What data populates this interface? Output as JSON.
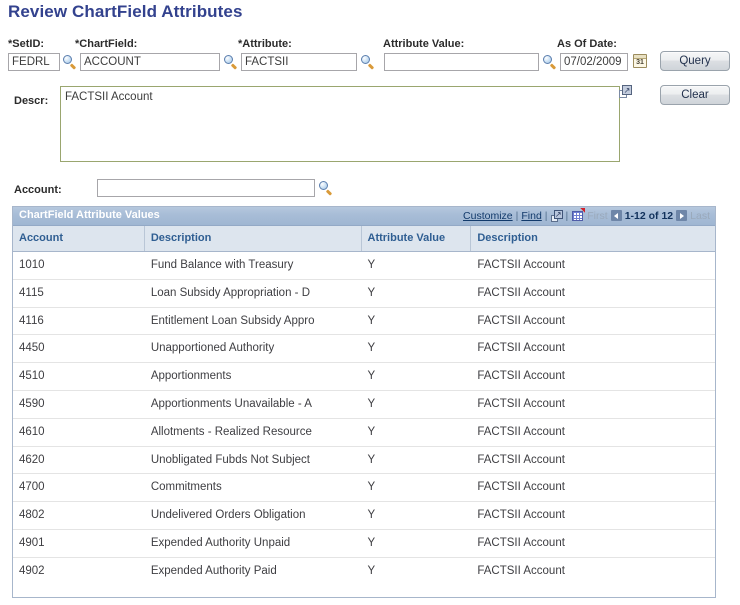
{
  "page": {
    "title": "Review ChartField Attributes"
  },
  "criteria": {
    "setid": {
      "label": "*SetID:",
      "value": "FEDRL",
      "placeholder": "",
      "lookup_icon": "magnifier-icon"
    },
    "chartfield": {
      "label": "*ChartField:",
      "value": "ACCOUNT",
      "placeholder": "",
      "lookup_icon": "magnifier-icon"
    },
    "attribute": {
      "label": "*Attribute:",
      "value": "FACTSII",
      "placeholder": "",
      "lookup_icon": "magnifier-icon"
    },
    "attribute_value": {
      "label": "Attribute Value:",
      "value": "",
      "placeholder": "",
      "lookup_icon": "magnifier-icon"
    },
    "as_of_date": {
      "label": "As Of Date:",
      "value": "07/02/2009",
      "placeholder": "",
      "calendar_icon": "calendar-icon",
      "calendar_glyph": "31"
    }
  },
  "buttons": {
    "query": "Query",
    "clear": "Clear"
  },
  "descr": {
    "label": "Descr:",
    "value": "FACTSII Account",
    "expand_icon": "expand-text-icon"
  },
  "account_filter": {
    "label": "Account:",
    "value": "",
    "placeholder": "",
    "lookup_icon": "magnifier-icon"
  },
  "grid": {
    "title": "ChartField Attribute Values",
    "tools": {
      "customize": "Customize",
      "separator": "|",
      "find": "Find",
      "expand_icon": "expand-all-icon",
      "download_icon": "download-grid-icon"
    },
    "nav": {
      "first": "First",
      "prev_icon": "previous-page-icon",
      "range": "1-12 of 12",
      "next_icon": "next-page-icon",
      "last": "Last"
    },
    "columns": [
      "Account",
      "Description",
      "Attribute Value",
      "Description"
    ],
    "rows": [
      [
        "1010",
        "Fund Balance with Treasury",
        "Y",
        "FACTSII Account"
      ],
      [
        "4115",
        "Loan Subsidy Appropriation - D",
        "Y",
        "FACTSII Account"
      ],
      [
        "4116",
        "Entitlement Loan Subsidy Appro",
        "Y",
        "FACTSII Account"
      ],
      [
        "4450",
        "Unapportioned Authority",
        "Y",
        "FACTSII Account"
      ],
      [
        "4510",
        "Apportionments",
        "Y",
        "FACTSII Account"
      ],
      [
        "4590",
        "Apportionments Unavailable - A",
        "Y",
        "FACTSII Account"
      ],
      [
        "4610",
        "Allotments - Realized Resource",
        "Y",
        "FACTSII Account"
      ],
      [
        "4620",
        "Unobligated Fubds Not Subject",
        "Y",
        "FACTSII Account"
      ],
      [
        "4700",
        "Commitments",
        "Y",
        "FACTSII Account"
      ],
      [
        "4802",
        "Undelivered Orders Obligation",
        "Y",
        "FACTSII Account"
      ],
      [
        "4901",
        "Expended Authority Unpaid",
        "Y",
        "FACTSII Account"
      ],
      [
        "4902",
        "Expended Authority Paid",
        "Y",
        "FACTSII Account"
      ]
    ]
  },
  "colors": {
    "title": "#33428e",
    "grid_header_text": "#2f5e92",
    "grid_titlebar": "#a8bdd7",
    "descr_border": "#9aa66f"
  }
}
